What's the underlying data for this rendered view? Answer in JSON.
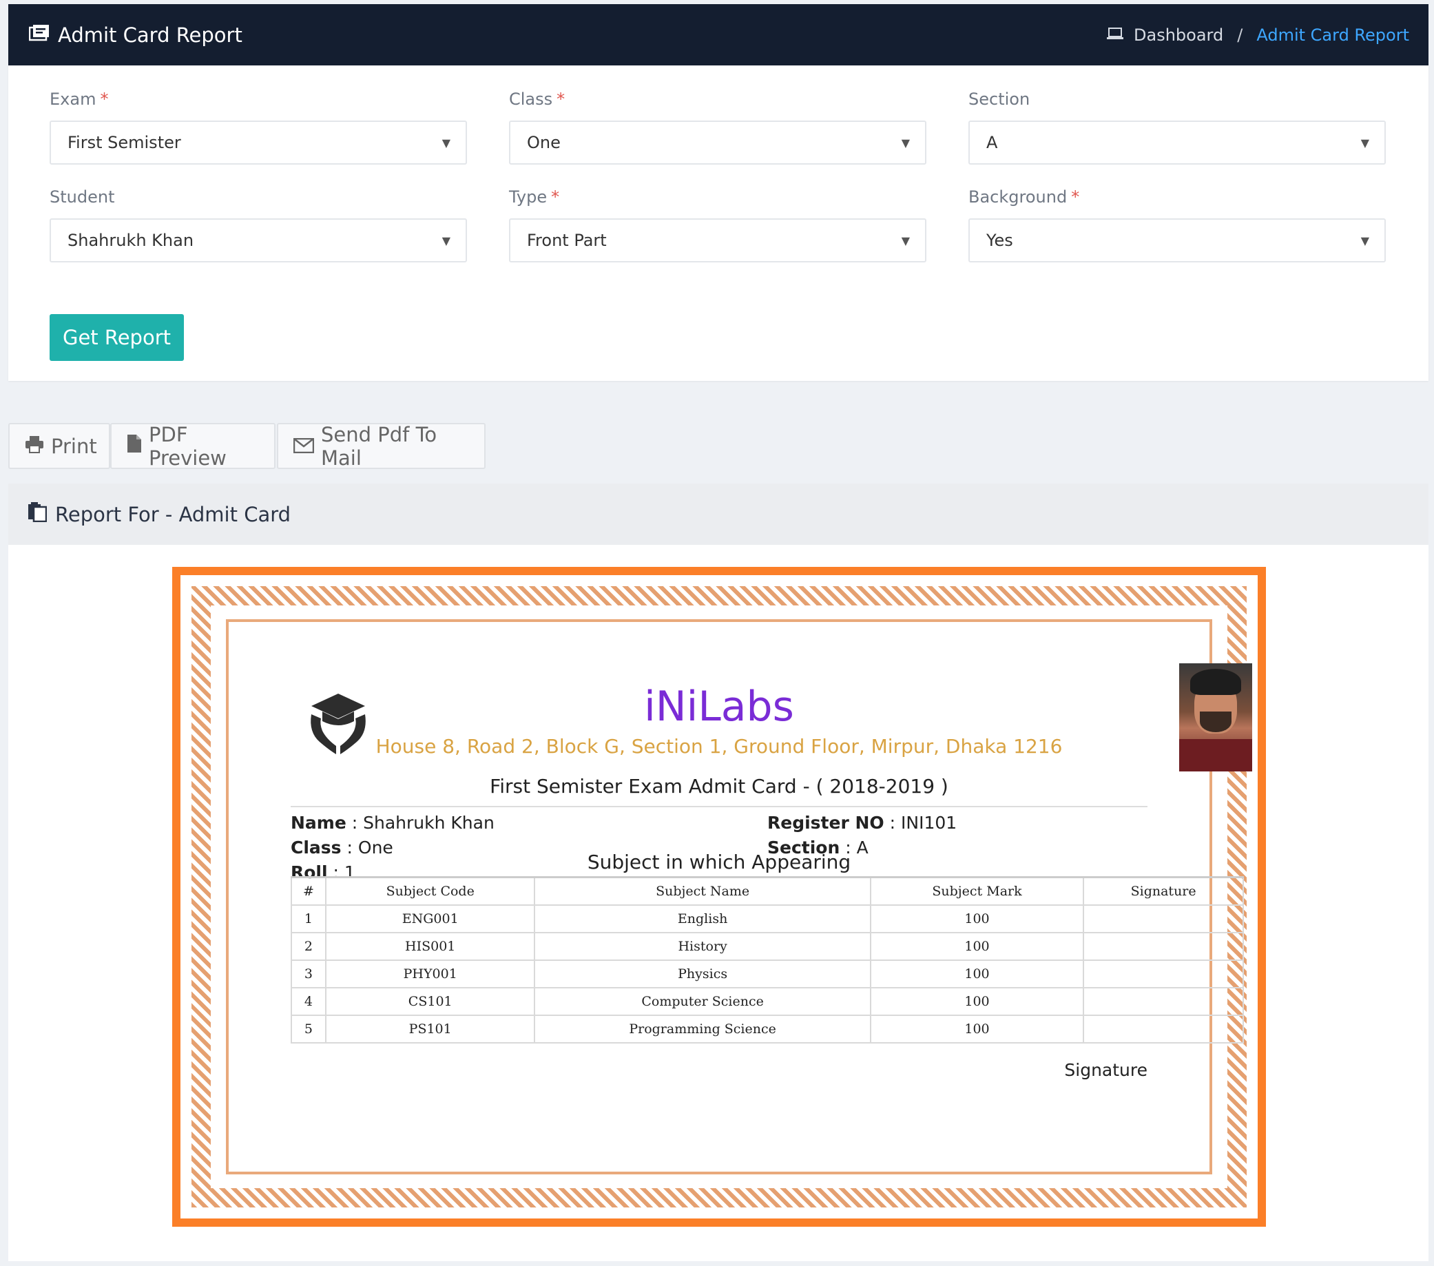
{
  "header": {
    "title": "Admit Card Report",
    "breadcrumb": {
      "home": "Dashboard",
      "separator": "/",
      "current": "Admit Card Report"
    }
  },
  "filters": {
    "exam": {
      "label": "Exam",
      "required": "*",
      "value": "First Semister"
    },
    "class": {
      "label": "Class",
      "required": "*",
      "value": "One"
    },
    "section": {
      "label": "Section",
      "value": "A"
    },
    "student": {
      "label": "Student",
      "value": "Shahrukh Khan"
    },
    "type": {
      "label": "Type",
      "required": "*",
      "value": "Front Part"
    },
    "background": {
      "label": "Background",
      "required": "*",
      "value": "Yes"
    },
    "submit_label": "Get Report"
  },
  "actions": {
    "print": "Print",
    "pdf_preview": "PDF Preview",
    "send_mail": "Send Pdf To Mail"
  },
  "report": {
    "heading": "Report For - Admit Card",
    "school_name": "iNiLabs",
    "address": "House 8, Road 2, Block G, Section 1, Ground Floor, Mirpur, Dhaka 1216",
    "card_title": "First Semister Exam Admit Card - ( 2018-2019 )",
    "student": {
      "name_label": "Name",
      "name": "Shahrukh Khan",
      "class_label": "Class",
      "class": "One",
      "roll_label": "Roll",
      "roll": "1",
      "register_label": "Register NO",
      "register": "INI101",
      "section_label": "Section",
      "section": "A"
    },
    "appearing_title": "Subject in which Appearing",
    "table": {
      "columns": [
        "#",
        "Subject Code",
        "Subject Name",
        "Subject Mark",
        "Signature"
      ],
      "rows": [
        [
          "1",
          "ENG001",
          "English",
          "100",
          ""
        ],
        [
          "2",
          "HIS001",
          "History",
          "100",
          ""
        ],
        [
          "3",
          "PHY001",
          "Physics",
          "100",
          ""
        ],
        [
          "4",
          "CS101",
          "Computer Science",
          "100",
          ""
        ],
        [
          "5",
          "PS101",
          "Programming Science",
          "100",
          ""
        ]
      ]
    },
    "signature": "Signature"
  },
  "colors": {
    "header_bg": "#141e30",
    "accent_link": "#3ea7ff",
    "button": "#1fb1ab",
    "card_border": "#fb7f28",
    "school_name": "#7a2cd6",
    "address": "#d9a343"
  }
}
